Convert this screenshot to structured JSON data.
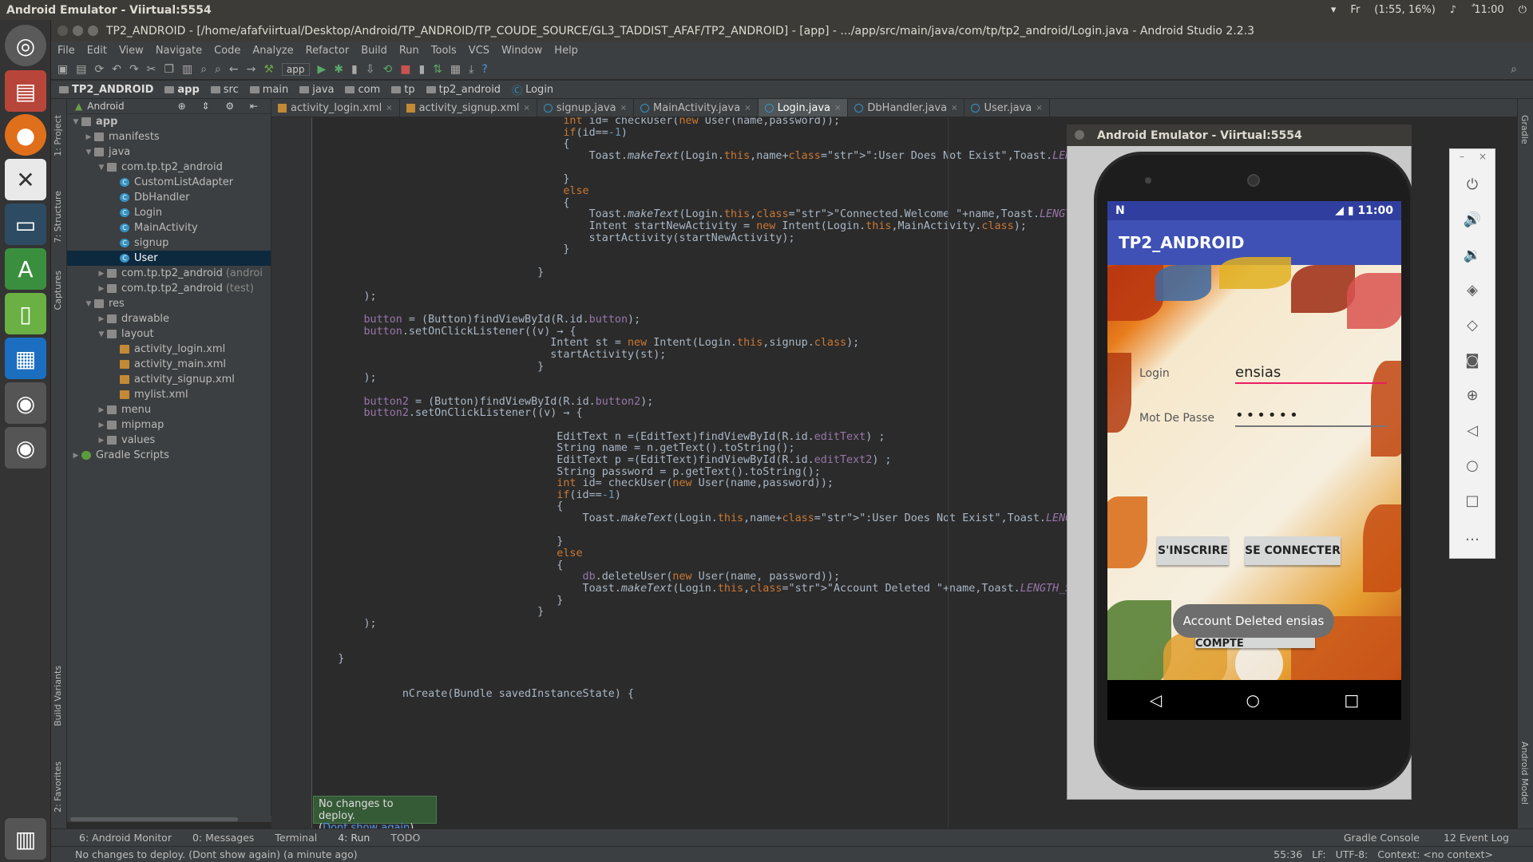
{
  "os": {
    "window_title": "Android Emulator - Viirtual:5554",
    "lang": "Fr",
    "battery": "(1:55, 16%)",
    "clock": "ٌ 11:00"
  },
  "ide": {
    "title": "TP2_ANDROID - [/home/afafviirtual/Desktop/Android/TP_ANDROID/TP_COUDE_SOURCE/GL3_TADDIST_AFAF/TP2_ANDROID] - [app] - .../app/src/main/java/com/tp/tp2_android/Login.java - Android Studio 2.2.3",
    "menu": [
      "File",
      "Edit",
      "View",
      "Navigate",
      "Code",
      "Analyze",
      "Refactor",
      "Build",
      "Run",
      "Tools",
      "VCS",
      "Window",
      "Help"
    ],
    "toolbar_combo": "app",
    "breadcrumb": [
      "TP2_ANDROID",
      "app",
      "src",
      "main",
      "java",
      "com",
      "tp",
      "tp2_android",
      "Login"
    ],
    "project_view": "Android",
    "left_tabs": [
      "1: Project",
      "7: Structure",
      "Captures",
      "Build Variants",
      "2: Favorites"
    ],
    "right_tabs": [
      "Gradle",
      "Android Model"
    ],
    "tree": [
      {
        "label": "app",
        "level": 0,
        "arrow": "▼",
        "icon": "folder",
        "bold": true
      },
      {
        "label": "manifests",
        "level": 1,
        "arrow": "▶",
        "icon": "folder"
      },
      {
        "label": "java",
        "level": 1,
        "arrow": "▼",
        "icon": "folder"
      },
      {
        "label": "com.tp.tp2_android",
        "level": 2,
        "arrow": "▼",
        "icon": "folder"
      },
      {
        "label": "CustomListAdapter",
        "level": 3,
        "arrow": "",
        "icon": "class"
      },
      {
        "label": "DbHandler",
        "level": 3,
        "arrow": "",
        "icon": "class"
      },
      {
        "label": "Login",
        "level": 3,
        "arrow": "",
        "icon": "class"
      },
      {
        "label": "MainActivity",
        "level": 3,
        "arrow": "",
        "icon": "class"
      },
      {
        "label": "signup",
        "level": 3,
        "arrow": "",
        "icon": "class"
      },
      {
        "label": "User",
        "level": 3,
        "arrow": "",
        "icon": "class",
        "selected": true
      },
      {
        "label": "com.tp.tp2_android",
        "suffix": "(androi",
        "level": 2,
        "arrow": "▶",
        "icon": "folder"
      },
      {
        "label": "com.tp.tp2_android",
        "suffix": "(test)",
        "level": 2,
        "arrow": "▶",
        "icon": "folder"
      },
      {
        "label": "res",
        "level": 1,
        "arrow": "▼",
        "icon": "folder"
      },
      {
        "label": "drawable",
        "level": 2,
        "arrow": "▶",
        "icon": "folder"
      },
      {
        "label": "layout",
        "level": 2,
        "arrow": "▼",
        "icon": "folder"
      },
      {
        "label": "activity_login.xml",
        "level": 3,
        "arrow": "",
        "icon": "xml"
      },
      {
        "label": "activity_main.xml",
        "level": 3,
        "arrow": "",
        "icon": "xml"
      },
      {
        "label": "activity_signup.xml",
        "level": 3,
        "arrow": "",
        "icon": "xml"
      },
      {
        "label": "mylist.xml",
        "level": 3,
        "arrow": "",
        "icon": "xml"
      },
      {
        "label": "menu",
        "level": 2,
        "arrow": "▶",
        "icon": "folder"
      },
      {
        "label": "mipmap",
        "level": 2,
        "arrow": "▶",
        "icon": "folder"
      },
      {
        "label": "values",
        "level": 2,
        "arrow": "▶",
        "icon": "folder"
      },
      {
        "label": "Gradle Scripts",
        "level": 0,
        "arrow": "▶",
        "icon": "gradle"
      }
    ],
    "tabs": [
      {
        "label": "activity_login.xml",
        "kind": "xml"
      },
      {
        "label": "activity_signup.xml",
        "kind": "xml"
      },
      {
        "label": "signup.java",
        "kind": "java"
      },
      {
        "label": "MainActivity.java",
        "kind": "java"
      },
      {
        "label": "Login.java",
        "kind": "java",
        "active": true
      },
      {
        "label": "DbHandler.java",
        "kind": "java"
      },
      {
        "label": "User.java",
        "kind": "java"
      }
    ],
    "code": [
      {
        "t": "int id= checkUser(new User(name,password));",
        "i": 39
      },
      {
        "t": "if(id==-1)",
        "i": 39
      },
      {
        "t": "{",
        "i": 39
      },
      {
        "t": "Toast.makeText(Login.this,name+\":User Does Not Exist\",Toast.LENGTH_SHORT).show();",
        "i": 43
      },
      {
        "t": "",
        "i": 0
      },
      {
        "t": "}",
        "i": 39
      },
      {
        "t": "else",
        "i": 39
      },
      {
        "t": "{",
        "i": 39
      },
      {
        "t": "Toast.makeText(Login.this,\"Connected.Welcome \"+name,Toast.LENGTH_SHORT).show();",
        "i": 43
      },
      {
        "t": "Intent startNewActivity = new Intent(Login.this,MainActivity.class);",
        "i": 43
      },
      {
        "t": "startActivity(startNewActivity);",
        "i": 43
      },
      {
        "t": "}",
        "i": 39
      },
      {
        "t": "",
        "i": 0
      },
      {
        "t": "}",
        "i": 35
      },
      {
        "t": "",
        "i": 0
      },
      {
        "t": ");",
        "i": 8
      },
      {
        "t": "",
        "i": 0
      },
      {
        "t": "button = (Button)findViewById(R.id.button);",
        "i": 8
      },
      {
        "t": "button.setOnClickListener((v) → {",
        "i": 8
      },
      {
        "t": "Intent st = new Intent(Login.this,signup.class);",
        "i": 37
      },
      {
        "t": "startActivity(st);",
        "i": 37
      },
      {
        "t": "}",
        "i": 35
      },
      {
        "t": ");",
        "i": 8
      },
      {
        "t": "",
        "i": 0
      },
      {
        "t": "button2 = (Button)findViewById(R.id.button2);",
        "i": 8
      },
      {
        "t": "button2.setOnClickListener((v) → {",
        "i": 8
      },
      {
        "t": "",
        "i": 0
      },
      {
        "t": "EditText n =(EditText)findViewById(R.id.editText) ;",
        "i": 38
      },
      {
        "t": "String name = n.getText().toString();",
        "i": 38
      },
      {
        "t": "EditText p =(EditText)findViewById(R.id.editText2) ;",
        "i": 38
      },
      {
        "t": "String password = p.getText().toString();",
        "i": 38
      },
      {
        "t": "int id= checkUser(new User(name,password));",
        "i": 38
      },
      {
        "t": "if(id==-1)",
        "i": 38
      },
      {
        "t": "{",
        "i": 38
      },
      {
        "t": "Toast.makeText(Login.this,name+\":User Does Not Exist\",Toast.LENGTH_SHORT).show();",
        "i": 42
      },
      {
        "t": "",
        "i": 0
      },
      {
        "t": "}",
        "i": 38
      },
      {
        "t": "else",
        "i": 38
      },
      {
        "t": "{",
        "i": 38
      },
      {
        "t": "db.deleteUser(new User(name, password));",
        "i": 42
      },
      {
        "t": "Toast.makeText(Login.this,\"Account Deleted \"+name,Toast.LENGTH_SHORT).show();",
        "i": 42
      },
      {
        "t": "}",
        "i": 38
      },
      {
        "t": "}",
        "i": 35
      },
      {
        "t": ");",
        "i": 8
      },
      {
        "t": "",
        "i": 0
      },
      {
        "t": "",
        "i": 0
      },
      {
        "t": "}",
        "i": 4
      },
      {
        "t": "",
        "i": 0
      },
      {
        "t": "",
        "i": 0
      },
      {
        "t": "nCreate(Bundle savedInstanceState) {",
        "i": 14
      }
    ],
    "balloon_text": "No changes to deploy.",
    "balloon_link": "Dont show again",
    "bottom_tools": [
      "6: Android Monitor",
      "0: Messages",
      "Terminal",
      "4: Run",
      "TODO"
    ],
    "bottom_right": [
      "Gradle Console",
      "12 Event Log"
    ],
    "status_message": "No changes to deploy. (Dont show again) (a minute ago)",
    "status_right": [
      "55:36",
      "LF:",
      "UTF-8:",
      "Context: <no context>"
    ]
  },
  "emulator": {
    "title": "Android Emulator - Viirtual:5554",
    "status_time": "11:00",
    "app_title": "TP2_ANDROID",
    "login_label": "Login",
    "login_value": "ensias",
    "password_label": "Mot De Passe",
    "password_value": "••••••",
    "signup_button": "S'INSCRIRE",
    "connect_button": "SE CONNECTER",
    "delete_button": "SUPPRIMER COMPTE",
    "toast": "Account Deleted ensias",
    "controls": [
      "power-icon",
      "volume-up-icon",
      "volume-down-icon",
      "rotate-left-icon",
      "rotate-right-icon",
      "camera-icon",
      "zoom-icon",
      "back-icon",
      "home-icon",
      "overview-icon",
      "more-icon"
    ]
  }
}
